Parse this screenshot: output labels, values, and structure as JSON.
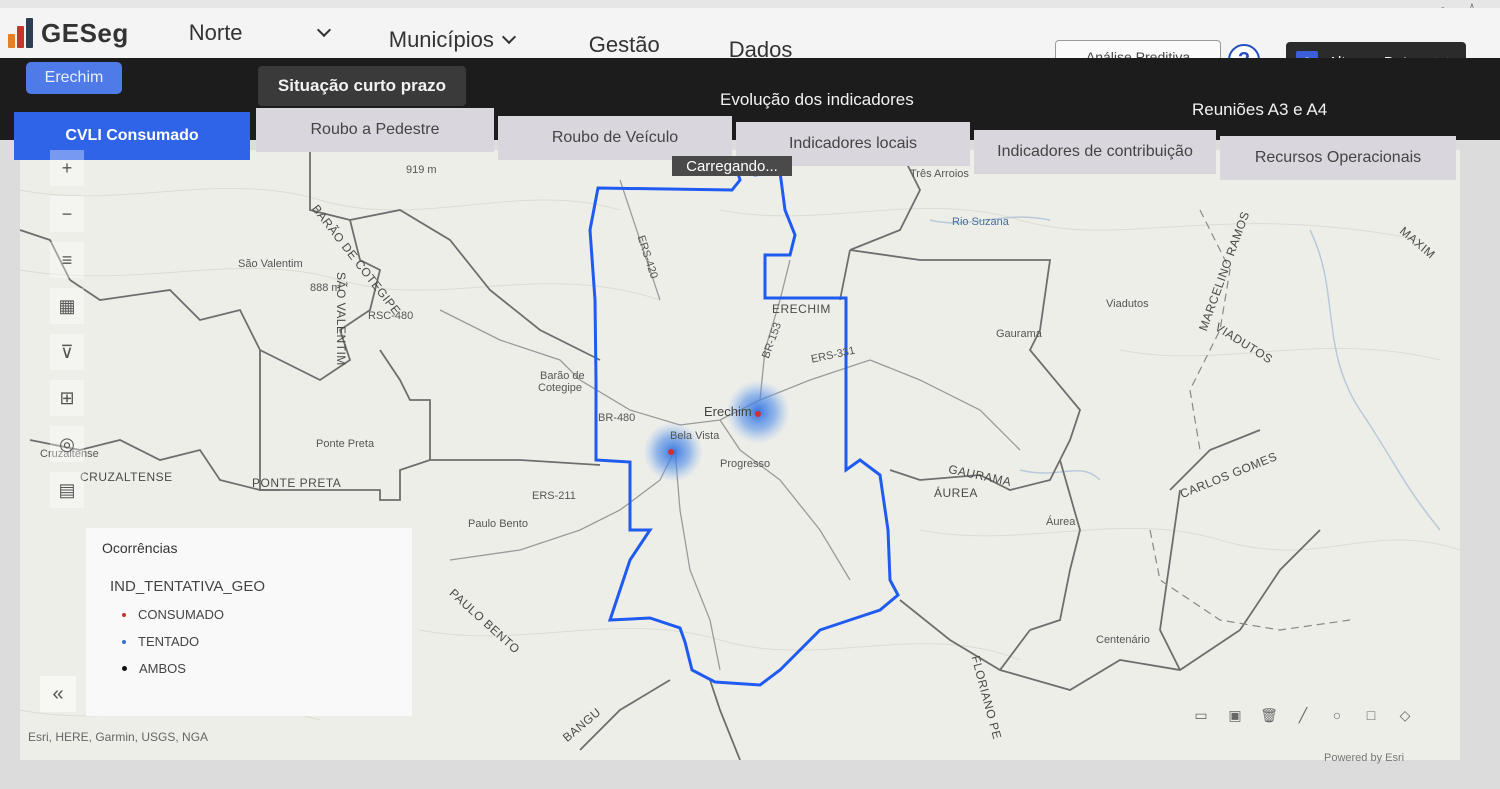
{
  "app": {
    "name": "GESeg"
  },
  "nav": [
    {
      "label": "Norte"
    },
    {
      "label": ""
    },
    {
      "label": "Municípios"
    },
    {
      "label": "Gestão"
    },
    {
      "label": "Dados"
    }
  ],
  "header": {
    "predictive_label": "Análise Preditiva",
    "help_label": "?",
    "user_initial": "A",
    "user_name": "Altemar Dutra"
  },
  "subbar": {
    "city": "Erechim",
    "short_term": "Situação curto prazo",
    "evolution": "Evolução dos indicadores",
    "meetings": "Reuniões A3 e A4"
  },
  "tabs": [
    {
      "label": "CVLI Consumado",
      "active": true
    },
    {
      "label": "Roubo a Pedestre",
      "active": false
    },
    {
      "label": "Roubo de Veículo",
      "active": false
    },
    {
      "label": "Indicadores locais",
      "active": false
    },
    {
      "label": "Indicadores de contribuição",
      "active": false
    },
    {
      "label": "Recursos Operacionais",
      "active": false
    }
  ],
  "map": {
    "loading": "Carregando...",
    "labels": {
      "tres_arroios": "Três Arroios",
      "rio_suzana": "Rio Suzana",
      "sao_valentim": "São Valentim",
      "barao_cotegipe_road": "BARÃO DE COTEGIPE",
      "sao_valentim_road": "SÃO VALENTIM",
      "erechim_upper": "ERECHIM",
      "viadutos": "Viadutos",
      "gaurama": "Gaurama",
      "barao_de": "Barão de",
      "cotegipe": "Cotegipe",
      "erechim": "Erechim",
      "bela_vista": "Bela Vista",
      "progresso": "Progresso",
      "ponte_preta": "Ponte Preta",
      "ponte_preta_upper": "PONTE PRETA",
      "cruzaltense": "Cruzaltense",
      "cruzaltense_upper": "CRUZALTENSE",
      "paulo_bento": "Paulo Bento",
      "paulo_bento_upper": "PAULO BENTO",
      "gaurama_upper": "GAURAMA",
      "aurea_upper": "ÁUREA",
      "aurea": "Áurea",
      "carlos_gomes": "CARLOS GOMES",
      "centenario": "Centenário",
      "marcelino_ramos": "MARCELINO RAMOS",
      "viadutos_upper": "VIADUTOS",
      "elev_919": "919 m",
      "elev_888": "888 m",
      "ers_420": "ERS-420",
      "ers_331": "ERS-331",
      "ers_211": "ERS-211",
      "br_480": "BR-480",
      "br_153": "BR-153",
      "rsc_480": "RSC-480",
      "bangu": "BANGU",
      "maxim": "MAXIM",
      "floriano": "FLORIANO PE"
    },
    "attribution": "Esri, HERE, Garmin, USGS, NGA",
    "powered_by": "Powered by Esri"
  },
  "legend": {
    "title": "Ocorrências",
    "layer": "IND_TENTATIVA_GEO",
    "items": [
      {
        "label": "CONSUMADO",
        "color": "#c0392b"
      },
      {
        "label": "TENTADO",
        "color": "#3b6fd6"
      },
      {
        "label": "AMBOS",
        "color": "#111111"
      }
    ]
  },
  "colors": {
    "accent": "#2f64e8",
    "boundary": "#1f5bf0",
    "hotspot": "#3b7fe0"
  }
}
